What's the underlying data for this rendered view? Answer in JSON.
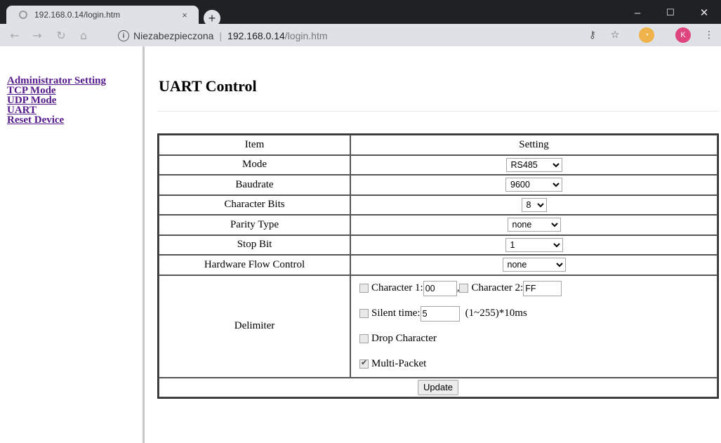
{
  "browser": {
    "tab_title": "192.168.0.14/login.htm",
    "new_tab_label": "+",
    "close_tab_glyph": "×",
    "minimize_glyph": "–",
    "maximize_glyph": "☐",
    "close_window_glyph": "✕",
    "security_label": "Niezabezpieczona",
    "url_host": "192.168.0.14",
    "url_path": "/login.htm",
    "profile_initial": "K",
    "colors": {
      "chrome_dark": "#202124",
      "toolbar": "#dee1e6",
      "profile": "#e0447c"
    }
  },
  "sidebar": {
    "items": [
      {
        "label": "Administrator Setting"
      },
      {
        "label": "TCP Mode"
      },
      {
        "label": "UDP Mode"
      },
      {
        "label": "UART"
      },
      {
        "label": "Reset Device"
      }
    ]
  },
  "page": {
    "title": "UART Control",
    "table": {
      "header_item": "Item",
      "header_setting": "Setting",
      "rows": [
        {
          "label": "Mode",
          "value": "RS485"
        },
        {
          "label": "Baudrate",
          "value": "9600"
        },
        {
          "label": "Character Bits",
          "value": "8"
        },
        {
          "label": "Parity Type",
          "value": "none"
        },
        {
          "label": "Stop Bit",
          "value": "1"
        },
        {
          "label": "Hardware Flow Control",
          "value": "none"
        }
      ]
    },
    "delimiter": {
      "label": "Delimiter",
      "char1_label": "Character 1:",
      "char1_value": "00",
      "comma": ",",
      "char2_label": "Character 2:",
      "char2_value": "FF",
      "silent_label": "Silent time:",
      "silent_value": "5",
      "silent_unit": "(1~255)*10ms",
      "drop_label": "Drop Character",
      "multi_label": "Multi-Packet",
      "multi_checked": true
    },
    "update_label": "Update"
  }
}
